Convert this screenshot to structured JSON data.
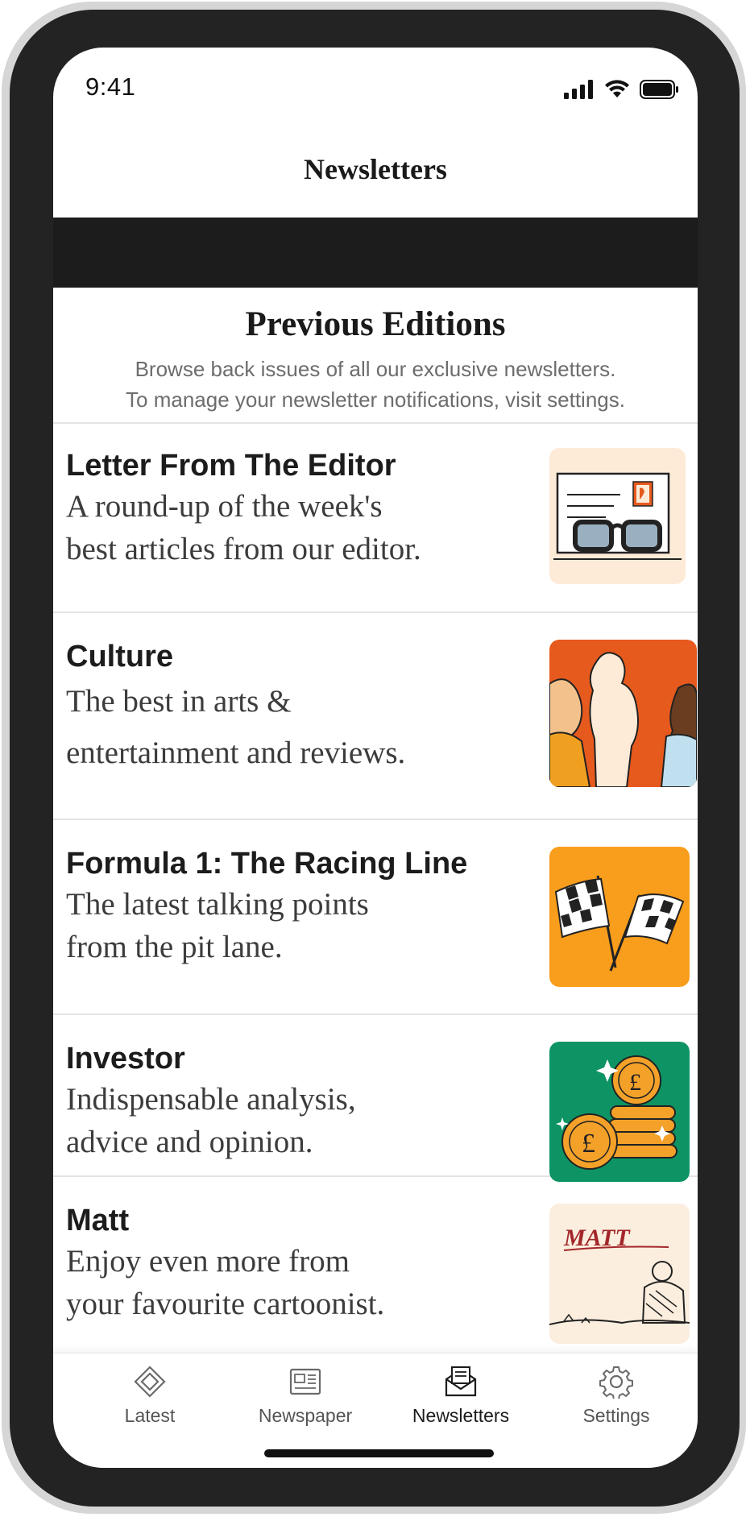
{
  "status_bar": {
    "time": "9:41"
  },
  "header": {
    "title": "Newsletters"
  },
  "intro": {
    "title": "Previous Editions",
    "line1": "Browse back issues of all our exclusive newsletters.",
    "line2": "To manage your newsletter notifications, visit settings."
  },
  "newsletters": [
    {
      "title": "Letter From The Editor",
      "desc_line1": "A round-up of the week's",
      "desc_line2": "best articles from our editor.",
      "thumb_bg": "#fdebd8"
    },
    {
      "title": "Culture",
      "desc_line1": "The best in arts &",
      "desc_line2": "entertainment  and reviews.",
      "thumb_bg": "#e65a1e"
    },
    {
      "title": "Formula 1: The Racing Line",
      "desc_line1": "The latest talking points",
      "desc_line2": "from the pit lane.",
      "thumb_bg": "#f99d1c"
    },
    {
      "title": "Investor",
      "desc_line1": "Indispensable analysis,",
      "desc_line2": "advice and opinion.",
      "thumb_bg": "#0e9464"
    },
    {
      "title": "Matt",
      "desc_line1": "Enjoy even more from",
      "desc_line2": "your favourite cartoonist.",
      "thumb_bg": "#fbeede",
      "thumb_text": "MATT"
    }
  ],
  "tabs": [
    {
      "label": "Latest",
      "icon": "diamond-icon"
    },
    {
      "label": "Newspaper",
      "icon": "newspaper-icon"
    },
    {
      "label": "Newsletters",
      "icon": "envelope-icon",
      "active": true
    },
    {
      "label": "Settings",
      "icon": "gear-icon"
    }
  ],
  "colors": {
    "banner": "#1c1c1c",
    "frame": "#222222",
    "text": "#1c1c1c",
    "muted": "#6d6d6d"
  }
}
